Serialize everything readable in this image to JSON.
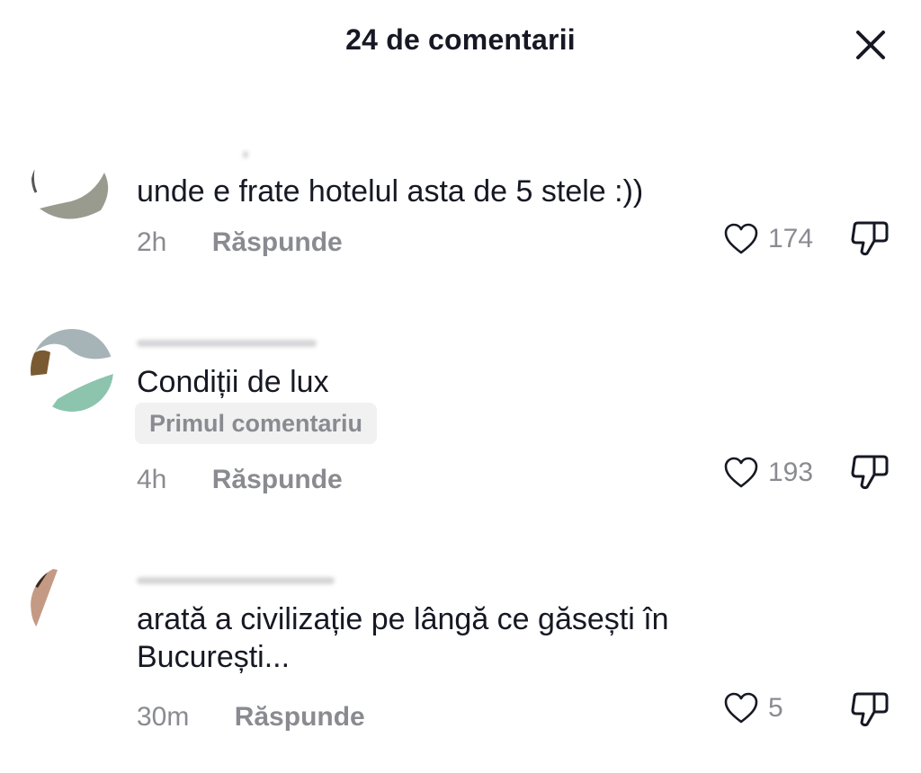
{
  "header": {
    "title": "24 de comentarii"
  },
  "icons": {
    "close": "close-icon",
    "like": "heart-outline-icon",
    "dislike": "thumbs-down-icon"
  },
  "colors": {
    "text": "#161823",
    "secondary": "#8a8b91",
    "badge_bg": "#f1f1f2"
  },
  "comments": [
    {
      "text": "unde e frate hotelul asta de 5 stele :))",
      "time": "2h",
      "reply_label": "Răspunde",
      "likes": "174"
    },
    {
      "text": "Condiții de lux",
      "badge": "Primul comentariu",
      "time": "4h",
      "reply_label": "Răspunde",
      "likes": "193"
    },
    {
      "text": "arată a civilizație pe lângă ce găsești în București...",
      "time": "30m",
      "reply_label": "Răspunde",
      "likes": "5"
    }
  ]
}
